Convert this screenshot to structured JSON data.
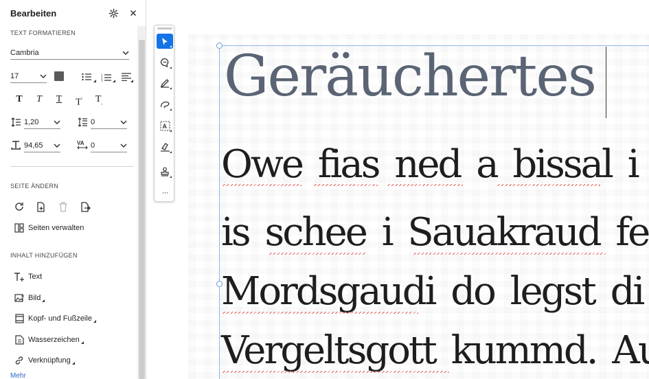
{
  "panel": {
    "title": "Bearbeiten",
    "settings_icon": "gear-icon",
    "close_icon": "close-icon"
  },
  "format": {
    "section_label": "TEXT FORMATIEREN",
    "font_family": "Cambria",
    "font_size": "17",
    "text_color": "#5b5b5b",
    "line_spacing": "1,20",
    "paragraph_spacing": "0",
    "horizontal_scale": "94,65",
    "character_spacing": "0",
    "style_buttons": [
      "T",
      "T",
      "T",
      "T",
      "T"
    ]
  },
  "page_section": {
    "label": "SEITE ÄNDERN",
    "manage_pages": "Seiten verwalten"
  },
  "content_section": {
    "label": "INHALT HINZUFÜGEN",
    "items": [
      {
        "label": "Text",
        "icon": "add-text-icon"
      },
      {
        "label": "Bild",
        "icon": "image-icon"
      },
      {
        "label": "Kopf- und Fußzeile",
        "icon": "header-footer-icon"
      },
      {
        "label": "Wasserzeichen",
        "icon": "watermark-icon"
      },
      {
        "label": "Verknüpfung",
        "icon": "link-icon"
      }
    ],
    "more": "Mehr"
  },
  "toolbar": {
    "tools": [
      "select-icon",
      "comment-icon",
      "pen-icon",
      "freehand-icon",
      "text-select-icon",
      "fill-sign-icon",
      "stamp-icon",
      "more-icon"
    ],
    "more_label": "···"
  },
  "document": {
    "heading": "Geräuchertes",
    "lines": [
      "Owe fias ned a bissal i m",
      "is schee i Sauakraud fe",
      "Mordsgaudi do legst di",
      "Vergeltsgott kummd. Au"
    ]
  },
  "colors": {
    "accent": "#1473e6",
    "heading_text": "#5a6474",
    "spellcheck": "#e5605a"
  }
}
